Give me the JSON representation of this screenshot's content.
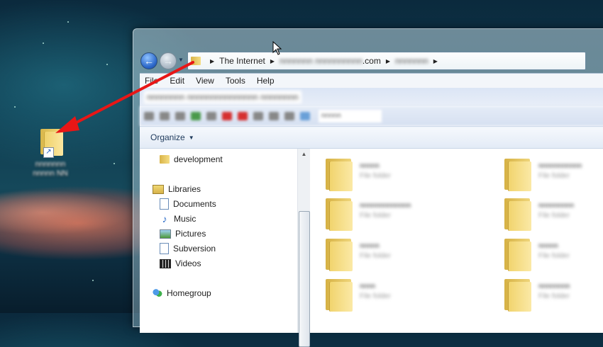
{
  "desktop": {
    "shortcut_label_line1": "nnnnnnn",
    "shortcut_label_line2": "nnnnn NN"
  },
  "address_bar": {
    "root": "The Internet",
    "host_blurred": "nnnnnnn nnnnnnnnnn",
    "host_suffix": ".com",
    "folder_blurred": "nnnnnnn"
  },
  "menu": [
    "File",
    "Edit",
    "View",
    "Tools",
    "Help"
  ],
  "blurred_bar_text": "nnnnnnnn nnnnnnnnnnnnnnn nnnnnnnn",
  "search_placeholder_blurred": "nnnnn",
  "command_bar": {
    "organize_label": "Organize"
  },
  "nav_tree": {
    "development": "development",
    "libraries": "Libraries",
    "documents": "Documents",
    "music": "Music",
    "pictures": "Pictures",
    "subversion": "Subversion",
    "videos": "Videos",
    "homegroup": "Homegroup"
  },
  "folders": [
    {
      "name": "nnnnn",
      "type": "File folder"
    },
    {
      "name": "nnnnnnnnnnn",
      "type": "File folder"
    },
    {
      "name": "nnnnnnnnnnnnn",
      "type": "File folder"
    },
    {
      "name": "nnnnnnnnn",
      "type": "File folder"
    },
    {
      "name": "nnnnn",
      "type": "File folder"
    },
    {
      "name": "nnnnn",
      "type": "File folder"
    },
    {
      "name": "nnnn",
      "type": "File folder"
    },
    {
      "name": "nnnnnnnn",
      "type": "File folder"
    }
  ],
  "colors": {
    "annotation_arrow": "#e81616",
    "accent_blue": "#2b67c9"
  },
  "icons": [
    "back-arrow-icon",
    "forward-arrow-icon",
    "folder-icon",
    "shortcut-arrow-icon",
    "library-icon",
    "music-note-icon",
    "pictures-icon",
    "videos-icon",
    "homegroup-icon",
    "mouse-cursor-icon"
  ]
}
